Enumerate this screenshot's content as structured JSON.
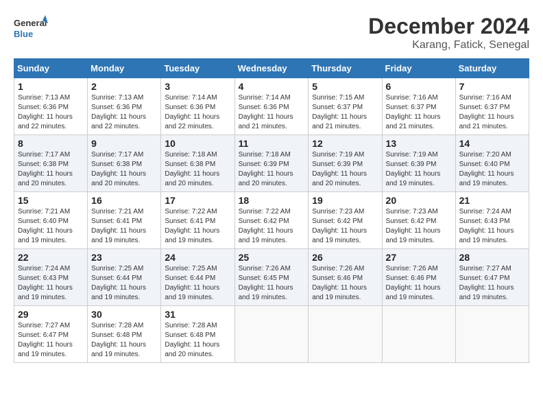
{
  "logo": {
    "line1": "General",
    "line2": "Blue"
  },
  "title": "December 2024",
  "location": "Karang, Fatick, Senegal",
  "days_header": [
    "Sunday",
    "Monday",
    "Tuesday",
    "Wednesday",
    "Thursday",
    "Friday",
    "Saturday"
  ],
  "weeks": [
    [
      {
        "day": "1",
        "sunrise": "7:13 AM",
        "sunset": "6:36 PM",
        "daylight": "11 hours and 22 minutes."
      },
      {
        "day": "2",
        "sunrise": "7:13 AM",
        "sunset": "6:36 PM",
        "daylight": "11 hours and 22 minutes."
      },
      {
        "day": "3",
        "sunrise": "7:14 AM",
        "sunset": "6:36 PM",
        "daylight": "11 hours and 22 minutes."
      },
      {
        "day": "4",
        "sunrise": "7:14 AM",
        "sunset": "6:36 PM",
        "daylight": "11 hours and 21 minutes."
      },
      {
        "day": "5",
        "sunrise": "7:15 AM",
        "sunset": "6:37 PM",
        "daylight": "11 hours and 21 minutes."
      },
      {
        "day": "6",
        "sunrise": "7:16 AM",
        "sunset": "6:37 PM",
        "daylight": "11 hours and 21 minutes."
      },
      {
        "day": "7",
        "sunrise": "7:16 AM",
        "sunset": "6:37 PM",
        "daylight": "11 hours and 21 minutes."
      }
    ],
    [
      {
        "day": "8",
        "sunrise": "7:17 AM",
        "sunset": "6:38 PM",
        "daylight": "11 hours and 20 minutes."
      },
      {
        "day": "9",
        "sunrise": "7:17 AM",
        "sunset": "6:38 PM",
        "daylight": "11 hours and 20 minutes."
      },
      {
        "day": "10",
        "sunrise": "7:18 AM",
        "sunset": "6:38 PM",
        "daylight": "11 hours and 20 minutes."
      },
      {
        "day": "11",
        "sunrise": "7:18 AM",
        "sunset": "6:39 PM",
        "daylight": "11 hours and 20 minutes."
      },
      {
        "day": "12",
        "sunrise": "7:19 AM",
        "sunset": "6:39 PM",
        "daylight": "11 hours and 20 minutes."
      },
      {
        "day": "13",
        "sunrise": "7:19 AM",
        "sunset": "6:39 PM",
        "daylight": "11 hours and 19 minutes."
      },
      {
        "day": "14",
        "sunrise": "7:20 AM",
        "sunset": "6:40 PM",
        "daylight": "11 hours and 19 minutes."
      }
    ],
    [
      {
        "day": "15",
        "sunrise": "7:21 AM",
        "sunset": "6:40 PM",
        "daylight": "11 hours and 19 minutes."
      },
      {
        "day": "16",
        "sunrise": "7:21 AM",
        "sunset": "6:41 PM",
        "daylight": "11 hours and 19 minutes."
      },
      {
        "day": "17",
        "sunrise": "7:22 AM",
        "sunset": "6:41 PM",
        "daylight": "11 hours and 19 minutes."
      },
      {
        "day": "18",
        "sunrise": "7:22 AM",
        "sunset": "6:42 PM",
        "daylight": "11 hours and 19 minutes."
      },
      {
        "day": "19",
        "sunrise": "7:23 AM",
        "sunset": "6:42 PM",
        "daylight": "11 hours and 19 minutes."
      },
      {
        "day": "20",
        "sunrise": "7:23 AM",
        "sunset": "6:42 PM",
        "daylight": "11 hours and 19 minutes."
      },
      {
        "day": "21",
        "sunrise": "7:24 AM",
        "sunset": "6:43 PM",
        "daylight": "11 hours and 19 minutes."
      }
    ],
    [
      {
        "day": "22",
        "sunrise": "7:24 AM",
        "sunset": "6:43 PM",
        "daylight": "11 hours and 19 minutes."
      },
      {
        "day": "23",
        "sunrise": "7:25 AM",
        "sunset": "6:44 PM",
        "daylight": "11 hours and 19 minutes."
      },
      {
        "day": "24",
        "sunrise": "7:25 AM",
        "sunset": "6:44 PM",
        "daylight": "11 hours and 19 minutes."
      },
      {
        "day": "25",
        "sunrise": "7:26 AM",
        "sunset": "6:45 PM",
        "daylight": "11 hours and 19 minutes."
      },
      {
        "day": "26",
        "sunrise": "7:26 AM",
        "sunset": "6:46 PM",
        "daylight": "11 hours and 19 minutes."
      },
      {
        "day": "27",
        "sunrise": "7:26 AM",
        "sunset": "6:46 PM",
        "daylight": "11 hours and 19 minutes."
      },
      {
        "day": "28",
        "sunrise": "7:27 AM",
        "sunset": "6:47 PM",
        "daylight": "11 hours and 19 minutes."
      }
    ],
    [
      {
        "day": "29",
        "sunrise": "7:27 AM",
        "sunset": "6:47 PM",
        "daylight": "11 hours and 19 minutes."
      },
      {
        "day": "30",
        "sunrise": "7:28 AM",
        "sunset": "6:48 PM",
        "daylight": "11 hours and 19 minutes."
      },
      {
        "day": "31",
        "sunrise": "7:28 AM",
        "sunset": "6:48 PM",
        "daylight": "11 hours and 20 minutes."
      },
      null,
      null,
      null,
      null
    ]
  ]
}
